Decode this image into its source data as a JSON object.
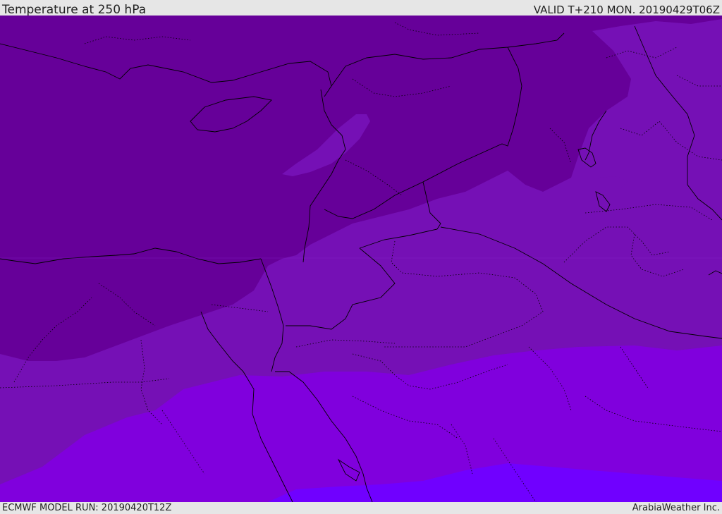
{
  "header": {
    "title": "Temperature at 250 hPa",
    "valid": "VALID T+210 MON. 20190429T06Z"
  },
  "footer": {
    "model_run": "ECMWF MODEL RUN: 20190420T12Z",
    "credit": "ArabiaWeather Inc."
  },
  "colors": {
    "coldest_band": "#660099",
    "cold_band": "#7510b5",
    "mid_band": "#8000dd",
    "warm_band": "#7000ff",
    "border_line": "#000000",
    "frame": "#e6e6e6"
  }
}
